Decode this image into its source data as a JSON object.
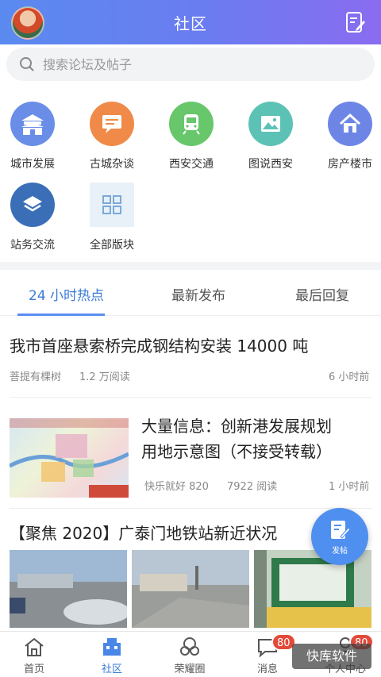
{
  "header": {
    "title": "社区"
  },
  "search": {
    "placeholder": "搜索论坛及帖子"
  },
  "categories": [
    {
      "label": "城市发展",
      "icon": "city-gate-icon",
      "color": "#6a8ee8"
    },
    {
      "label": "古城杂谈",
      "icon": "chat-bubble-icon",
      "color": "#f08a48"
    },
    {
      "label": "西安交通",
      "icon": "train-icon",
      "color": "#67c76a"
    },
    {
      "label": "图说西安",
      "icon": "picture-icon",
      "color": "#5cc2b6"
    },
    {
      "label": "房产楼市",
      "icon": "house-icon",
      "color": "#6d86e6"
    },
    {
      "label": "站务交流",
      "icon": "layers-icon",
      "color": "#3a6fb8"
    },
    {
      "label": "全部版块",
      "icon": "grid-icon",
      "color": "#7aa9d8"
    }
  ],
  "tabs": [
    {
      "label": "24 小时热点",
      "active": true
    },
    {
      "label": "最新发布",
      "active": false
    },
    {
      "label": "最后回复",
      "active": false
    }
  ],
  "posts": [
    {
      "title": "我市首座悬索桥完成钢结构安装 14000 吨",
      "author": "菩提有棵树",
      "reads": "1.2 万阅读",
      "time": "6 小时前"
    },
    {
      "title_line1": "大量信息：创新港发展规划",
      "title_line2": "用地示意图（不接受转载）",
      "author": "快乐就好 820",
      "reads": "7922 阅读",
      "time": "1 小时前"
    },
    {
      "title": "【聚焦 2020】广泰门地铁站新近状况"
    }
  ],
  "fab": {
    "label": "发帖"
  },
  "nav": [
    {
      "label": "首页",
      "icon": "home-icon",
      "active": false
    },
    {
      "label": "社区",
      "icon": "community-icon",
      "active": true
    },
    {
      "label": "荣耀圈",
      "icon": "honor-circle-icon",
      "active": false
    },
    {
      "label": "消息",
      "icon": "message-icon",
      "active": false,
      "badge": "80"
    },
    {
      "label": "个人中心",
      "icon": "profile-icon",
      "active": false,
      "badge": "80"
    }
  ],
  "watermark": "快库软件",
  "colors": {
    "accent": "#3a7bd5",
    "header_start": "#5a8af0",
    "header_end": "#8a6cf0",
    "badge": "#e24a3a"
  }
}
